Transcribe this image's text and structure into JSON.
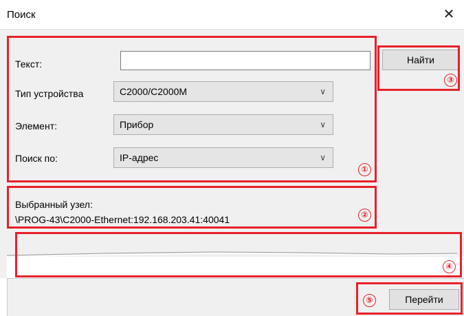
{
  "window": {
    "title": "Поиск",
    "close_glyph": "✕"
  },
  "form": {
    "text_label": "Текст:",
    "text_value": "",
    "device_type_label": "Тип устройства",
    "device_type_value": "С2000/С2000М",
    "element_label": "Элемент:",
    "element_value": "Прибор",
    "search_by_label": "Поиск по:",
    "search_by_value": "IP-адрес"
  },
  "selected_node": {
    "label": "Выбранный узел:",
    "path": "\\PROG-43\\С2000-Ethernet:192.168.203.41:40041"
  },
  "buttons": {
    "find": "Найти",
    "go": "Перейти"
  },
  "annotations": {
    "color": "#e8202a",
    "badges": [
      "①",
      "②",
      "③",
      "④",
      "⑤"
    ]
  },
  "icons": {
    "chevron": "chevron-down-icon",
    "close": "close-icon"
  }
}
